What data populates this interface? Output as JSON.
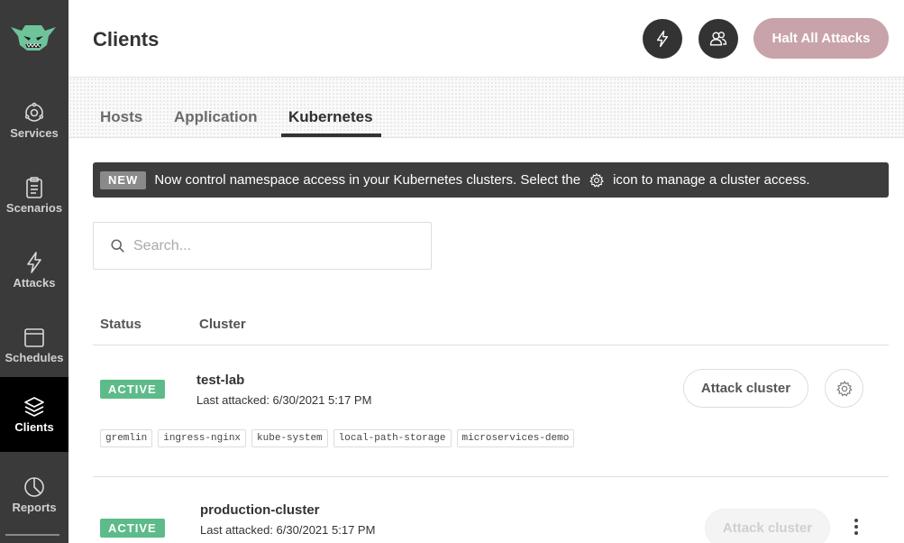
{
  "sidebar": {
    "logo_icon": "gremlin-logo-icon",
    "items": [
      {
        "label": "Services",
        "icon": "services-icon"
      },
      {
        "label": "Scenarios",
        "icon": "clipboard-icon"
      },
      {
        "label": "Attacks",
        "icon": "lightning-icon"
      },
      {
        "label": "Schedules",
        "icon": "calendar-icon"
      },
      {
        "label": "Clients",
        "icon": "layers-icon",
        "active": true
      },
      {
        "label": "Reports",
        "icon": "pie-chart-icon"
      }
    ]
  },
  "header": {
    "title": "Clients",
    "halt_label": "Halt All Attacks",
    "halt_color": "#c8a3a9"
  },
  "tabs": [
    {
      "label": "Hosts"
    },
    {
      "label": "Application"
    },
    {
      "label": "Kubernetes",
      "active": true
    }
  ],
  "banner": {
    "badge": "NEW",
    "text_before": "Now control namespace access in your Kubernetes clusters. Select the",
    "text_after": "icon to manage a cluster access."
  },
  "search": {
    "placeholder": "Search...",
    "value": ""
  },
  "table": {
    "columns": [
      "Status",
      "Cluster"
    ],
    "rows": [
      {
        "status": "ACTIVE",
        "name": "test-lab",
        "last_attacked": "Last attacked: 6/30/2021 5:17 PM",
        "namespaces": [
          "gremlin",
          "ingress-nginx",
          "kube-system",
          "local-path-storage",
          "microservices-demo"
        ],
        "action_label": "Attack cluster"
      },
      {
        "status": "ACTIVE",
        "name": "production-cluster",
        "last_attacked": "Last attacked: 6/30/2021 5:17 PM",
        "action_label": "Attack cluster"
      }
    ]
  },
  "colors": {
    "active_badge": "#5dbb8a",
    "sidebar_bg": "#3a3a3a",
    "banner_bg": "#3d3d3d"
  }
}
